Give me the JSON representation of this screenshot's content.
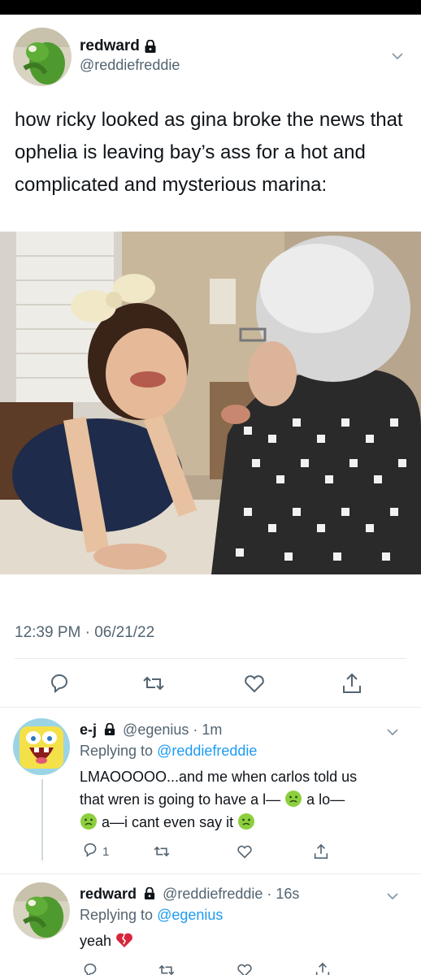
{
  "main_tweet": {
    "display_name": "redward",
    "handle": "@reddiefreddie",
    "text": "how ricky looked as gina broke the news that ophelia is leaving bay’s ass for a hot and complicated and mysterious marina:",
    "timestamp": "12:39 PM · 06/21/22"
  },
  "replies": [
    {
      "display_name": "e-j",
      "handle_time": "@egenius · 1m",
      "replying_prefix": "Replying to ",
      "replying_to": "@reddiefreddie",
      "text_line1": "LMAOOOOO...and me when carlos told us",
      "text_line2a": "that wren is going to have a l—",
      "text_line2b": "a lo—",
      "text_line3": "a—i cant even say it",
      "reply_count": "1"
    },
    {
      "display_name": "redward",
      "handle_time": "@reddiefreddie · 16s",
      "replying_prefix": "Replying to ",
      "replying_to": "@egenius",
      "text": "yeah"
    }
  ],
  "icons": [
    "lock-icon",
    "chevron-down-icon",
    "reply-icon",
    "retweet-icon",
    "like-icon",
    "share-icon",
    "nauseated-face-emoji",
    "broken-heart-emoji"
  ],
  "colors": {
    "link": "#1d9bf0",
    "secondary": "#536471",
    "text": "#0f1419"
  }
}
